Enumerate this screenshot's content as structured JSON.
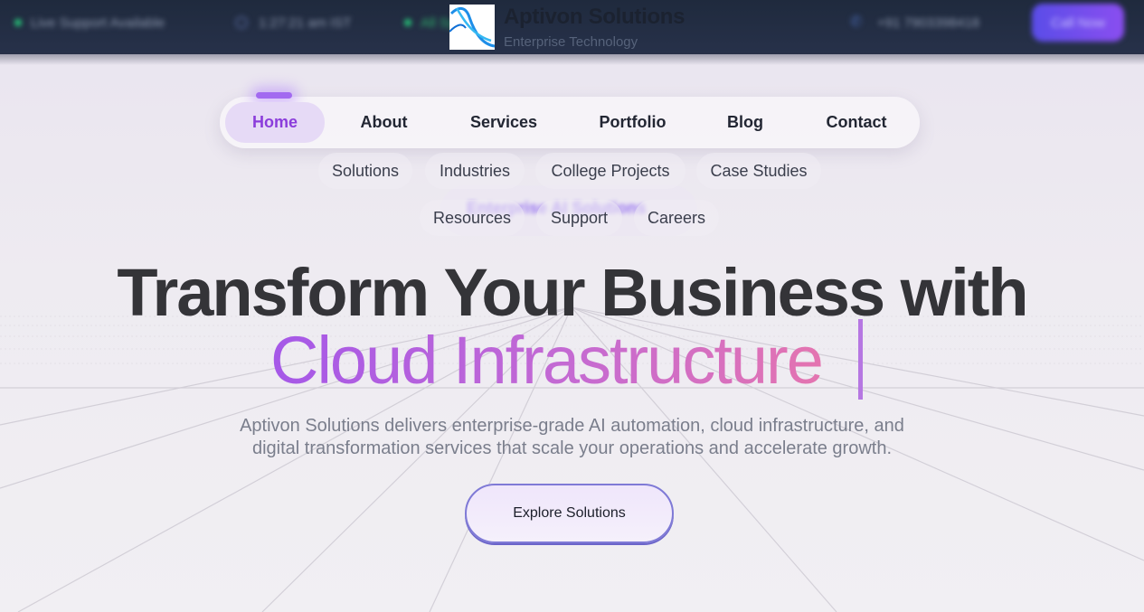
{
  "topbar": {
    "support": "Live Support Available",
    "time": "1:27:21 am IST",
    "status": "All Systems",
    "phone": "+91 7903398418",
    "call_now": "Call Now"
  },
  "brand": {
    "name": "Aptivon Solutions",
    "tagline": "Enterprise Technology"
  },
  "nav": {
    "items": [
      "Home",
      "About",
      "Services",
      "Portfolio",
      "Blog",
      "Contact"
    ],
    "active": "Home"
  },
  "subnav": {
    "row1": [
      "Solutions",
      "Industries",
      "College Projects",
      "Case Studies"
    ],
    "row2": [
      "Resources",
      "Support",
      "Careers"
    ]
  },
  "badge_text": "Enterprise AI Solutions",
  "hero": {
    "title_line1": "Transform Your Business with",
    "title_line2": "Cloud Infrastructure",
    "description_line1": "Aptivon Solutions delivers enterprise-grade AI automation, cloud infrastructure, and",
    "description_line2": "digital transformation services that scale your operations and accelerate growth.",
    "cta": "Explore Solutions"
  },
  "colors": {
    "accent": "#8b3ddb",
    "gradient_start": "#a558e8",
    "gradient_end": "#e474b0",
    "topbar_bg": "#1f2a3d"
  }
}
